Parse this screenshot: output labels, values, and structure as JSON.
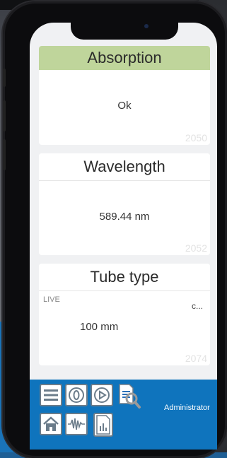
{
  "cards": {
    "absorption": {
      "title": "Absorption",
      "value": "Ok",
      "id": "2050"
    },
    "wavelength": {
      "title": "Wavelength",
      "value": "589.44 nm",
      "id": "2052"
    },
    "tube_type": {
      "title": "Tube type",
      "value": "100 mm",
      "id": "2074",
      "live": "LIVE",
      "more": "c..."
    }
  },
  "toolbar": {
    "user": "Administrator",
    "buttons": [
      "menu-icon",
      "zero-icon",
      "play-icon",
      "document-search-icon",
      "home-icon",
      "waveform-icon",
      "report-icon"
    ]
  },
  "colors": {
    "header_green": "#bfd59b",
    "toolbar_blue": "#0f74bd"
  }
}
